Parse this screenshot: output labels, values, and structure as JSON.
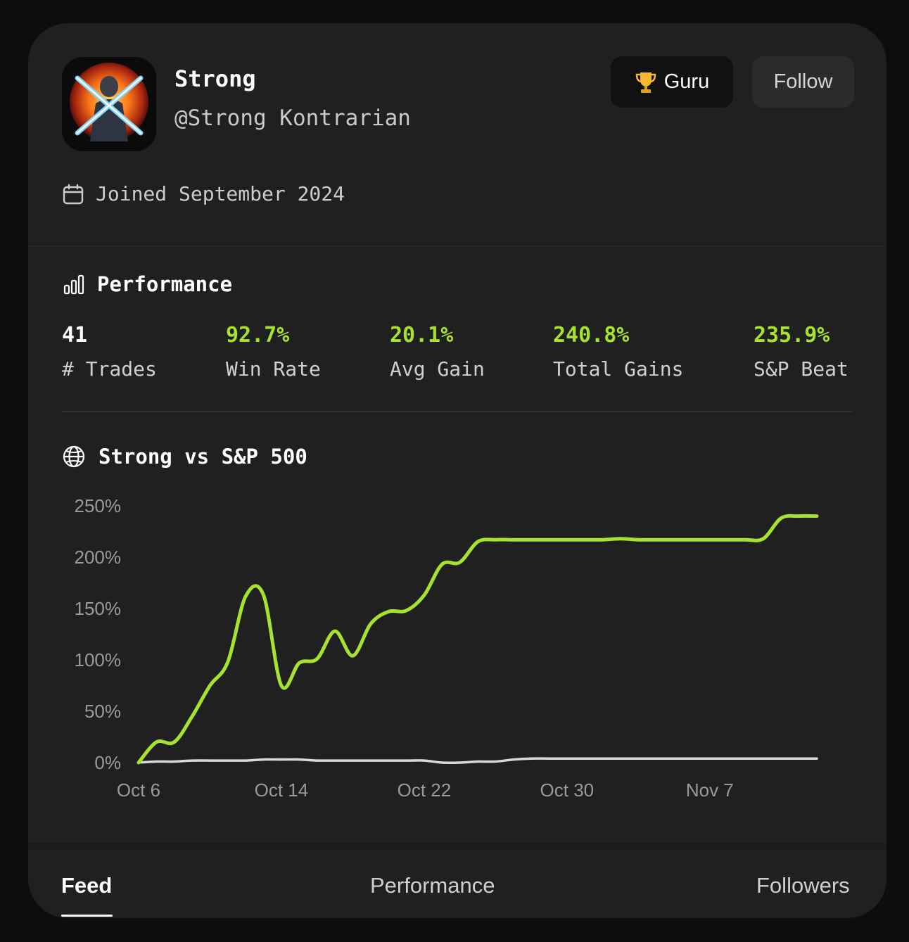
{
  "profile": {
    "name": "Strong",
    "handle": "@Strong Kontrarian",
    "avatar_icon": "crossed-swords-avatar",
    "joined": "Joined September 2024"
  },
  "actions": {
    "guru_label": "Guru",
    "follow_label": "Follow"
  },
  "performance": {
    "title": "Performance",
    "stats": [
      {
        "value": "41",
        "label": "# Trades"
      },
      {
        "value": "92.7%",
        "label": "Win Rate"
      },
      {
        "value": "20.1%",
        "label": "Avg Gain"
      },
      {
        "value": "240.8%",
        "label": "Total Gains"
      },
      {
        "value": "235.9%",
        "label": "S&P Beat"
      }
    ]
  },
  "chart": {
    "title": "Strong vs S&P 500"
  },
  "chart_data": {
    "type": "line",
    "ylim": [
      0,
      250
    ],
    "yticks": [
      "0%",
      "50%",
      "100%",
      "150%",
      "200%",
      "250%"
    ],
    "xticks": [
      "Oct 6",
      "Oct 14",
      "Oct 22",
      "Oct 30",
      "Nov 7"
    ],
    "x": [
      "Oct 6",
      "Oct 7",
      "Oct 8",
      "Oct 9",
      "Oct 10",
      "Oct 11",
      "Oct 12",
      "Oct 13",
      "Oct 14",
      "Oct 15",
      "Oct 16",
      "Oct 17",
      "Oct 18",
      "Oct 19",
      "Oct 20",
      "Oct 21",
      "Oct 22",
      "Oct 23",
      "Oct 24",
      "Oct 25",
      "Oct 26",
      "Oct 27",
      "Oct 28",
      "Oct 29",
      "Oct 30",
      "Oct 31",
      "Nov 1",
      "Nov 2",
      "Nov 3",
      "Nov 4",
      "Nov 5",
      "Nov 6",
      "Nov 7",
      "Nov 8",
      "Nov 9",
      "Nov 10",
      "Nov 11",
      "Nov 12",
      "Nov 13"
    ],
    "series": [
      {
        "color": "#a6e22e",
        "values": [
          0,
          20,
          20,
          45,
          75,
          98,
          162,
          163,
          75,
          97,
          101,
          128,
          104,
          135,
          147,
          148,
          163,
          193,
          195,
          215,
          217,
          217,
          217,
          217,
          217,
          217,
          217,
          218,
          217,
          217,
          217,
          217,
          217,
          217,
          217,
          218,
          238,
          240,
          240
        ]
      },
      {
        "color": "#d9d9d9",
        "values": [
          0,
          1,
          1,
          2,
          2,
          2,
          2,
          3,
          3,
          3,
          2,
          2,
          2,
          2,
          2,
          2,
          2,
          0,
          0,
          1,
          1,
          3,
          4,
          4,
          4,
          4,
          4,
          4,
          4,
          4,
          4,
          4,
          4,
          4,
          4,
          4,
          4,
          4,
          4
        ]
      }
    ],
    "grid": false,
    "legend": "none"
  },
  "tabs": [
    {
      "label": "Feed"
    },
    {
      "label": "Performance"
    },
    {
      "label": "Followers"
    }
  ],
  "colors": {
    "accent_green": "#a6e22e",
    "benchmark_line": "#d9d9d9",
    "card_background": "#202020"
  }
}
